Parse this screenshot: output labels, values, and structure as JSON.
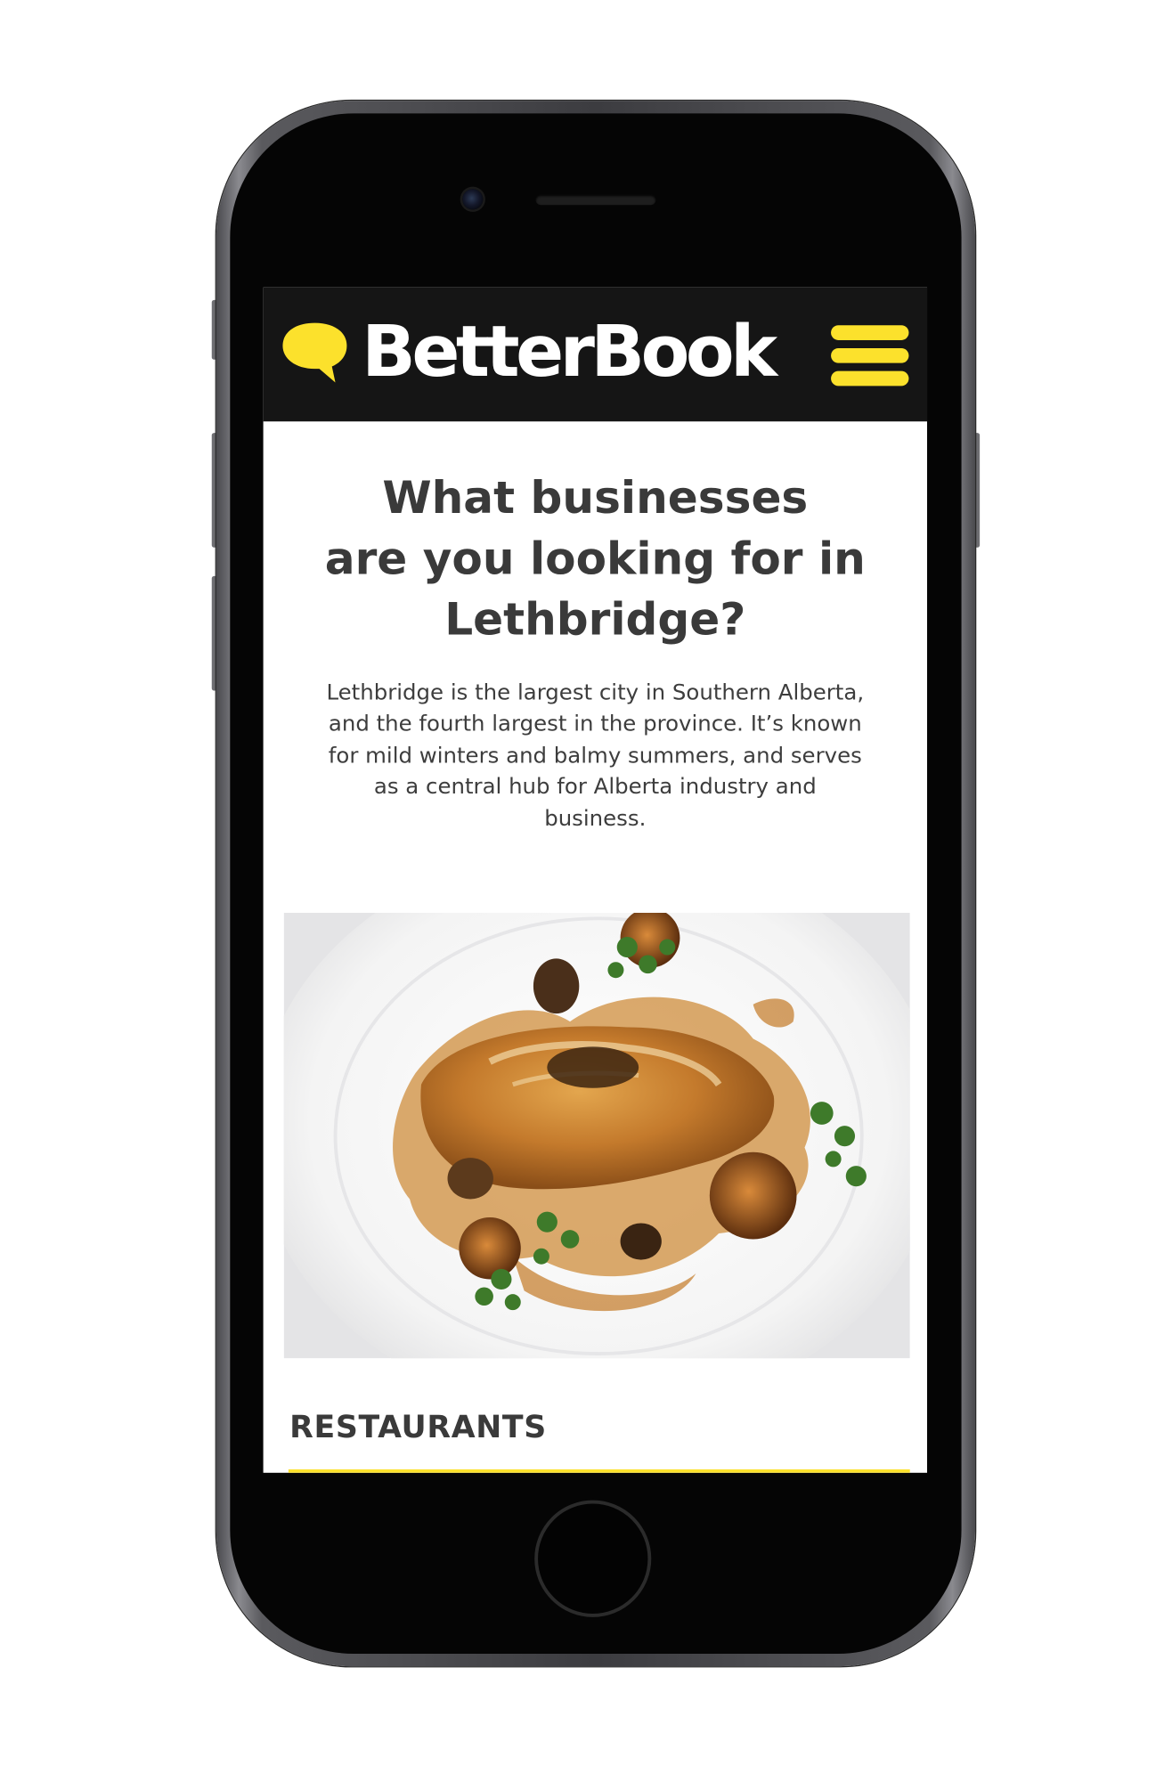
{
  "site": {
    "brand_name": "BetterBook",
    "accent_color": "#fce12c",
    "header_color": "#151515"
  },
  "hero": {
    "title_line1": "What businesses",
    "title_line2": "are you looking for in",
    "title_line3": "Lethbridge?",
    "intro_line1": "Lethbridge is the largest city in Southern Alberta,",
    "intro_line2": "and the fourth largest in the province.  It’s known",
    "intro_line3": "for mild winters and balmy summers, and serves",
    "intro_line4": "as a central hub for Alberta industry and",
    "intro_line5": "business."
  },
  "categories": [
    {
      "label": "RESTAURANTS",
      "image": "plated-chicken-dish"
    }
  ],
  "icons": {
    "logo": "speech-bubble-icon",
    "menu": "hamburger-menu-icon"
  }
}
